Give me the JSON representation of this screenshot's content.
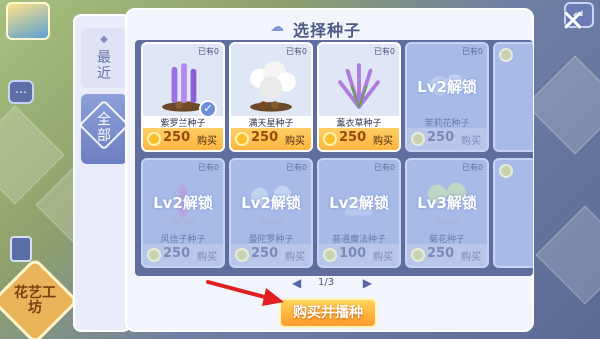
{
  "header": {
    "title": "选择种子"
  },
  "tabs": [
    {
      "label": "最近",
      "active": false
    },
    {
      "label": "全部",
      "active": true
    }
  ],
  "cards_row1": [
    {
      "name": "紫罗兰种子",
      "owned": "已有0",
      "price": "250",
      "buy": "购买",
      "locked": false,
      "selected": true,
      "color": "#a070d8"
    },
    {
      "name": "满天星种子",
      "owned": "已有0",
      "price": "250",
      "buy": "购买",
      "locked": false,
      "selected": false,
      "color": "#f3f3f3"
    },
    {
      "name": "薰衣草种子",
      "owned": "已有0",
      "price": "250",
      "buy": "购买",
      "locked": false,
      "selected": false,
      "color": "#c88fe0"
    },
    {
      "name": "茉莉花种子",
      "owned": "已有0",
      "price": "250",
      "buy": "购买",
      "locked": true,
      "lock": "Lv2解锁"
    }
  ],
  "cards_row2": [
    {
      "name": "风信子种子",
      "owned": "已有0",
      "price": "250",
      "buy": "购买",
      "locked": true,
      "lock": "Lv2解锁"
    },
    {
      "name": "曼陀罗种子",
      "owned": "已有0",
      "price": "250",
      "buy": "购买",
      "locked": true,
      "lock": "Lv2解锁"
    },
    {
      "name": "普通魔法种子",
      "owned": "已有0",
      "price": "100",
      "buy": "购买",
      "locked": true,
      "lock": "Lv2解锁"
    },
    {
      "name": "菊花种子",
      "owned": "已有0",
      "price": "250",
      "buy": "购买",
      "locked": true,
      "lock": "Lv3解锁"
    }
  ],
  "pager": {
    "text": "1/3"
  },
  "actions": {
    "buy_and_plant": "购买并播种"
  },
  "sidebar": {
    "workshop": "花艺工坊"
  },
  "colors": {
    "accent_gold": "#ffb540",
    "panel_bg": "#f3f5fc",
    "grid_bg": "#5f6e9f",
    "locked_card": "#a8bbe8",
    "arrow": "#e02020"
  }
}
